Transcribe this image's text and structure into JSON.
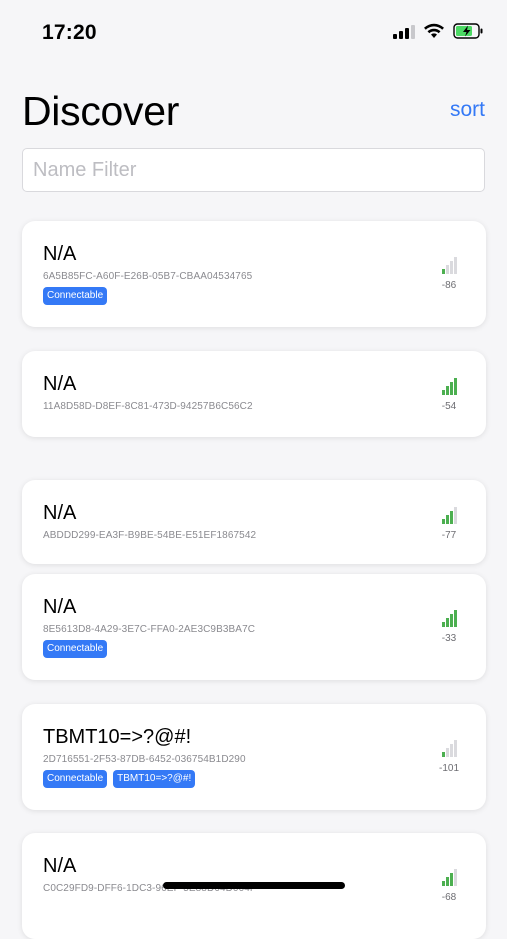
{
  "status_bar": {
    "time": "17:20"
  },
  "header": {
    "title": "Discover",
    "sort_label": "sort"
  },
  "filter": {
    "placeholder": "Name Filter",
    "value": ""
  },
  "colors": {
    "accent": "#3479f6",
    "signal_green": "#4caf50"
  },
  "devices": [
    {
      "name": "N/A",
      "uuid": "6A5B85FC-A60F-E26B-05B7-CBAA04534765",
      "badges": [
        "Connectable"
      ],
      "rssi": "-86",
      "signal_level": 1
    },
    {
      "name": "N/A",
      "uuid": "11A8D58D-D8EF-8C81-473D-94257B6C56C2",
      "badges": [],
      "rssi": "-54",
      "signal_level": 4
    },
    {
      "name": "N/A",
      "uuid": "ABDDD299-EA3F-B9BE-54BE-E51EF1867542",
      "badges": [],
      "rssi": "-77",
      "signal_level": 3
    },
    {
      "name": "N/A",
      "uuid": "8E5613D8-4A29-3E7C-FFA0-2AE3C9B3BA7C",
      "badges": [
        "Connectable"
      ],
      "rssi": "-33",
      "signal_level": 4
    },
    {
      "name": "TBMT10=>?@#!",
      "uuid": "2D716551-2F53-87DB-6452-036754B1D290",
      "badges": [
        "Connectable",
        "TBMT10=>?@#!"
      ],
      "rssi": "-101",
      "signal_level": 1
    },
    {
      "name": "N/A",
      "uuid": "C0C29FD9-DFF6-1DC3-96EF-5E88D64D004F",
      "badges": [],
      "rssi": "-68",
      "signal_level": 3
    }
  ]
}
